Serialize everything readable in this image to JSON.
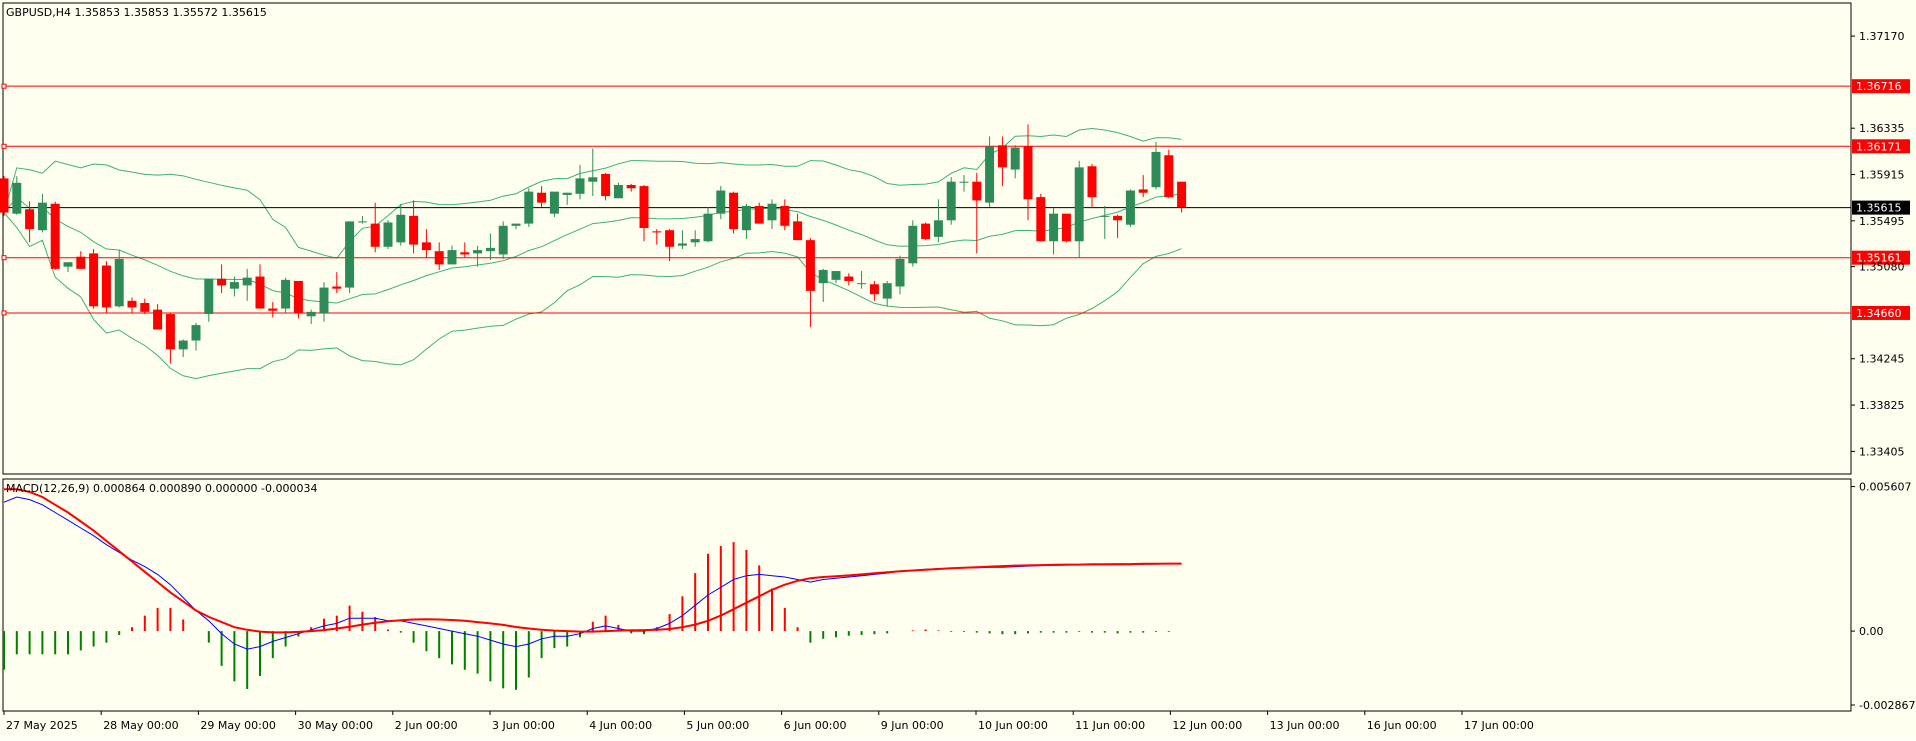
{
  "main_header": "GBPUSD,H4  1.35853 1.35853 1.35572 1.35615",
  "macd_header": "MACD(12,26,9) 0.000864 0.000890 0.000000 -0.000034",
  "colors": {
    "background": "#fffff0",
    "bull": "#2e8b57",
    "bear": "#ff0000",
    "bollinger": "#3cb371",
    "level_line": "#ff0000",
    "current_price_line": "#000000",
    "macd_line": "#0000ff",
    "signal_line": "#ff0000",
    "grid": "none"
  },
  "chart_data": [
    {
      "type": "candlestick",
      "symbol": "GBPUSD",
      "timeframe": "H4",
      "ylim": [
        1.332,
        1.3747
      ],
      "price_ticks": [
        "1.37170",
        "1.36335",
        "1.35915",
        "1.35495",
        "1.35080",
        "1.34245",
        "1.33825",
        "1.33405"
      ],
      "x_labels": [
        "27 May 2025",
        "28 May 00:00",
        "29 May 00:00",
        "30 May 00:00",
        "2 Jun 00:00",
        "3 Jun 00:00",
        "4 Jun 00:00",
        "5 Jun 00:00",
        "6 Jun 00:00",
        "9 Jun 00:00",
        "10 Jun 00:00",
        "11 Jun 00:00",
        "12 Jun 00:00",
        "13 Jun 00:00",
        "16 Jun 00:00",
        "17 Jun 00:00"
      ],
      "hlines": [
        {
          "label": "1.36716",
          "value": 1.36716
        },
        {
          "label": "1.36171",
          "value": 1.36171
        },
        {
          "label": "1.35161",
          "value": 1.35161
        },
        {
          "label": "1.34660",
          "value": 1.3466
        }
      ],
      "current_price": {
        "label": "1.35615",
        "value": 1.35615
      },
      "candles": [
        [
          1.3588,
          1.359,
          1.3554,
          1.3557
        ],
        [
          1.3556,
          1.359,
          1.3555,
          1.3584
        ],
        [
          1.356,
          1.3567,
          1.353,
          1.3542
        ],
        [
          1.3541,
          1.3574,
          1.3539,
          1.3566
        ],
        [
          1.3565,
          1.3567,
          1.3505,
          1.3506
        ],
        [
          1.3508,
          1.3512,
          1.3503,
          1.3512
        ],
        [
          1.3517,
          1.3522,
          1.3506,
          1.3506
        ],
        [
          1.352,
          1.3524,
          1.347,
          1.3472
        ],
        [
          1.3509,
          1.3513,
          1.3466,
          1.3471
        ],
        [
          1.3472,
          1.3523,
          1.3471,
          1.3515
        ],
        [
          1.3477,
          1.348,
          1.3466,
          1.3471
        ],
        [
          1.3475,
          1.3479,
          1.3465,
          1.3467
        ],
        [
          1.3469,
          1.3474,
          1.3453,
          1.3451
        ],
        [
          1.3465,
          1.3466,
          1.342,
          1.3433
        ],
        [
          1.3433,
          1.3442,
          1.3426,
          1.3441
        ],
        [
          1.3441,
          1.3457,
          1.3432,
          1.3455
        ],
        [
          1.3465,
          1.3495,
          1.3458,
          1.3497
        ],
        [
          1.3497,
          1.351,
          1.3484,
          1.3491
        ],
        [
          1.3488,
          1.3499,
          1.3481,
          1.3494
        ],
        [
          1.3491,
          1.3506,
          1.3477,
          1.3498
        ],
        [
          1.3499,
          1.351,
          1.3471,
          1.347
        ],
        [
          1.347,
          1.3476,
          1.3462,
          1.3468
        ],
        [
          1.347,
          1.3498,
          1.3466,
          1.3496
        ],
        [
          1.3495,
          1.3495,
          1.3461,
          1.3466
        ],
        [
          1.3463,
          1.3469,
          1.3456,
          1.3467
        ],
        [
          1.3466,
          1.3494,
          1.3458,
          1.3489
        ],
        [
          1.349,
          1.3503,
          1.3484,
          1.3488
        ],
        [
          1.3489,
          1.3549,
          1.3484,
          1.3549
        ],
        [
          1.3549,
          1.3554,
          1.3547,
          1.3549
        ],
        [
          1.3547,
          1.3566,
          1.3521,
          1.3526
        ],
        [
          1.3526,
          1.355,
          1.3524,
          1.3548
        ],
        [
          1.353,
          1.3565,
          1.3527,
          1.3555
        ],
        [
          1.3554,
          1.3568,
          1.352,
          1.3528
        ],
        [
          1.353,
          1.3542,
          1.3516,
          1.3523
        ],
        [
          1.3522,
          1.353,
          1.3505,
          1.351
        ],
        [
          1.351,
          1.3527,
          1.351,
          1.3523
        ],
        [
          1.3521,
          1.353,
          1.3516,
          1.3519
        ],
        [
          1.352,
          1.3527,
          1.3508,
          1.3523
        ],
        [
          1.3522,
          1.3538,
          1.3514,
          1.3525
        ],
        [
          1.3519,
          1.3549,
          1.3515,
          1.3545
        ],
        [
          1.3545,
          1.3547,
          1.3542,
          1.3547
        ],
        [
          1.3547,
          1.3579,
          1.3544,
          1.3576
        ],
        [
          1.3575,
          1.3581,
          1.3562,
          1.3566
        ],
        [
          1.3556,
          1.3575,
          1.3553,
          1.3576
        ],
        [
          1.3573,
          1.3575,
          1.3564,
          1.3575
        ],
        [
          1.3574,
          1.36,
          1.3569,
          1.3588
        ],
        [
          1.3585,
          1.3615,
          1.3572,
          1.3589
        ],
        [
          1.3592,
          1.3593,
          1.3568,
          1.3572
        ],
        [
          1.357,
          1.3584,
          1.357,
          1.3582
        ],
        [
          1.3582,
          1.3583,
          1.3576,
          1.3579
        ],
        [
          1.3581,
          1.3582,
          1.3531,
          1.3543
        ],
        [
          1.354,
          1.3542,
          1.3528,
          1.3539
        ],
        [
          1.3541,
          1.3542,
          1.3513,
          1.3526
        ],
        [
          1.3527,
          1.3541,
          1.3524,
          1.3529
        ],
        [
          1.353,
          1.3541,
          1.3526,
          1.3533
        ],
        [
          1.3531,
          1.3562,
          1.353,
          1.3556
        ],
        [
          1.3556,
          1.3581,
          1.3551,
          1.3577
        ],
        [
          1.3575,
          1.3576,
          1.3538,
          1.3542
        ],
        [
          1.3541,
          1.3565,
          1.3533,
          1.3563
        ],
        [
          1.3563,
          1.3566,
          1.3547,
          1.3547
        ],
        [
          1.355,
          1.3569,
          1.3542,
          1.3565
        ],
        [
          1.3563,
          1.3569,
          1.3541,
          1.3545
        ],
        [
          1.3549,
          1.3556,
          1.3534,
          1.3532
        ],
        [
          1.3532,
          1.3534,
          1.3453,
          1.3486
        ],
        [
          1.3493,
          1.3506,
          1.3476,
          1.3505
        ],
        [
          1.3496,
          1.3504,
          1.3493,
          1.3504
        ],
        [
          1.3499,
          1.3502,
          1.3491,
          1.3495
        ],
        [
          1.3493,
          1.3504,
          1.3488,
          1.3493
        ],
        [
          1.3492,
          1.3495,
          1.3477,
          1.3483
        ],
        [
          1.3479,
          1.3495,
          1.3472,
          1.3493
        ],
        [
          1.349,
          1.3518,
          1.3483,
          1.3515
        ],
        [
          1.3511,
          1.355,
          1.3508,
          1.3545
        ],
        [
          1.3547,
          1.3548,
          1.3532,
          1.3533
        ],
        [
          1.3535,
          1.3569,
          1.353,
          1.355
        ],
        [
          1.355,
          1.3589,
          1.3546,
          1.3585
        ],
        [
          1.3585,
          1.3591,
          1.3576,
          1.3585
        ],
        [
          1.3585,
          1.3593,
          1.352,
          1.3568
        ],
        [
          1.3566,
          1.3626,
          1.3562,
          1.3617
        ],
        [
          1.3618,
          1.3626,
          1.3581,
          1.3598
        ],
        [
          1.3596,
          1.3618,
          1.3588,
          1.3616
        ],
        [
          1.3617,
          1.3637,
          1.355,
          1.3569
        ],
        [
          1.3571,
          1.3574,
          1.3531,
          1.3531
        ],
        [
          1.3531,
          1.3561,
          1.3519,
          1.3556
        ],
        [
          1.3556,
          1.3556,
          1.353,
          1.3531
        ],
        [
          1.3531,
          1.3604,
          1.3516,
          1.3598
        ],
        [
          1.3599,
          1.3601,
          1.3561,
          1.3571
        ],
        [
          1.3554,
          1.3563,
          1.3533,
          1.3554
        ],
        [
          1.3554,
          1.3555,
          1.3534,
          1.355
        ],
        [
          1.3546,
          1.3578,
          1.3544,
          1.3577
        ],
        [
          1.3578,
          1.3591,
          1.3571,
          1.3575
        ],
        [
          1.358,
          1.3621,
          1.3578,
          1.3612
        ],
        [
          1.3609,
          1.3614,
          1.357,
          1.3571
        ],
        [
          1.3585,
          1.3585,
          1.3557,
          1.3562
        ]
      ]
    },
    {
      "type": "line",
      "name": "MACD(12,26,9)",
      "ylim": [
        -0.0031,
        0.0059
      ],
      "ticks": [
        "0.005607",
        "0.00",
        "-0.002867"
      ],
      "macd": [
        0.005,
        0.0052,
        0.0051,
        0.0049,
        0.0046,
        0.0043,
        0.004,
        0.0037,
        0.00335,
        0.00305,
        0.00275,
        0.0025,
        0.0022,
        0.0018,
        0.0013,
        0.0008,
        0.0004,
        -0.0001,
        -0.0005,
        -0.0007,
        -0.0006,
        -0.0004,
        -0.00025,
        -0.0001,
        5e-05,
        0.0002,
        0.0003,
        0.0005,
        0.0005,
        0.0005,
        0.0004,
        0.0004,
        0.0003,
        0.0002,
        0.0001,
        0.0,
        -0.0001,
        -0.0002,
        -0.00035,
        -0.0005,
        -0.0006,
        -0.0005,
        -0.0003,
        -0.0002,
        -0.0002,
        -0.0001,
        0.0001,
        0.0002,
        0.0001,
        0.0,
        0.0,
        0.0001,
        0.0003,
        0.0006,
        0.001,
        0.0014,
        0.0017,
        0.002,
        0.00215,
        0.0022,
        0.00215,
        0.0021,
        0.002,
        0.0019,
        0.002,
        0.00205,
        0.0021,
        0.00215,
        0.0022,
        0.00225,
        0.00232,
        0.00236,
        0.0024,
        0.00242,
        0.00243,
        0.00245,
        0.00246,
        0.00247,
        0.00248,
        0.0025,
        0.00252,
        0.00254,
        0.00255,
        0.00256,
        0.00257,
        0.00257,
        0.00257,
        0.00257,
        0.00258,
        0.00259,
        0.0026,
        0.00261,
        0.00262
      ],
      "signal": [
        0.0055,
        0.0055,
        0.0054,
        0.0052,
        0.0049,
        0.0046,
        0.00425,
        0.0039,
        0.0035,
        0.0031,
        0.0027,
        0.0023,
        0.0019,
        0.0015,
        0.00115,
        0.0008,
        0.00055,
        0.00035,
        0.00015,
        5e-05,
        -2e-05,
        -5e-05,
        -5e-05,
        -3e-05,
        0.0,
        4e-05,
        0.0001,
        0.00017,
        0.00025,
        0.00032,
        0.00038,
        0.00042,
        0.00045,
        0.00046,
        0.00045,
        0.00043,
        0.0004,
        0.00035,
        0.0003,
        0.00024,
        0.00016,
        0.0001,
        5e-05,
        2e-05,
        0.0,
        -2e-05,
        -2e-05,
        0.0,
        2e-05,
        3e-05,
        4e-05,
        5e-05,
        8e-05,
        0.00015,
        0.00025,
        0.0004,
        0.0006,
        0.00085,
        0.0011,
        0.00135,
        0.0016,
        0.0018,
        0.00195,
        0.00205,
        0.0021,
        0.00213,
        0.00216,
        0.0022,
        0.00224,
        0.00228,
        0.00232,
        0.00235,
        0.00238,
        0.00241,
        0.00244,
        0.00246,
        0.00248,
        0.0025,
        0.00252,
        0.00254,
        0.00255,
        0.00256,
        0.00257,
        0.00258,
        0.00258,
        0.00259,
        0.00259,
        0.0026,
        0.0026,
        0.00261,
        0.00261,
        0.00262,
        0.00262
      ]
    }
  ]
}
